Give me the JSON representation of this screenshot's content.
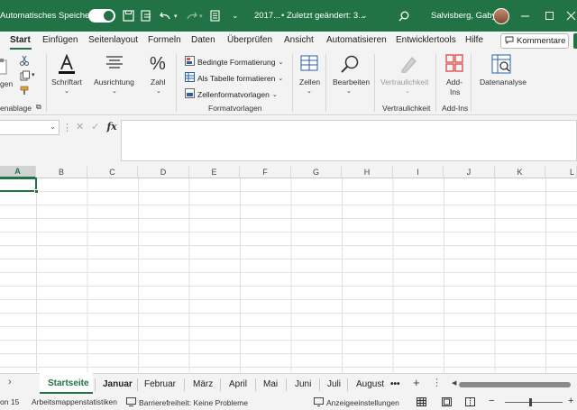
{
  "titlebar": {
    "autosave_label": "Automatisches Speichern",
    "filename": "2017...",
    "changed": "• Zuletzt geändert: 3...",
    "user": "Salvisberg, Gaby",
    "colors": {
      "brand": "#217346"
    }
  },
  "tabs": [
    "Start",
    "Einfügen",
    "Seitenlayout",
    "Formeln",
    "Daten",
    "Überprüfen",
    "Ansicht",
    "Automatisieren",
    "Entwicklertools",
    "Hilfe"
  ],
  "comments_label": "Kommentare",
  "ribbon": {
    "clipboard_partial": "gen",
    "clipboard_group": "enablage",
    "font": "Schriftart",
    "alignment": "Ausrichtung",
    "number": "Zahl",
    "cond_format": "Bedingte Formatierung",
    "as_table": "Als Tabelle formatieren",
    "cell_styles": "Zellenformatvorlagen",
    "styles_group": "Formatvorlagen",
    "cells": "Zellen",
    "editing": "Bearbeiten",
    "sensitivity": "Vertraulichkeit",
    "sensitivity_group": "Vertraulichkeit",
    "addins_line1": "Add-",
    "addins_line2": "Ins",
    "addins_group": "Add-Ins",
    "data_analysis": "Datenanalyse"
  },
  "formula_bar": {
    "fx": "fx",
    "cancel": "✕",
    "confirm": "✓",
    "more": "⋮"
  },
  "columns": [
    "A",
    "B",
    "C",
    "D",
    "E",
    "F",
    "G",
    "H",
    "I",
    "J",
    "K",
    "L"
  ],
  "selected_cell": "A1",
  "sheets": [
    "Startseite",
    "Januar",
    "Februar",
    "März",
    "April",
    "Mai",
    "Juni",
    "Juli",
    "August"
  ],
  "sheet_more": "•••",
  "sheet_add": "+",
  "status": {
    "partial": "on 15",
    "workbook_stats": "Arbeitsmappenstatistiken",
    "accessibility": "Barrierefreiheit: Keine Probleme",
    "display_settings": "Anzeigeeinstellungen",
    "zoom_minus": "−",
    "zoom_plus": "+"
  }
}
